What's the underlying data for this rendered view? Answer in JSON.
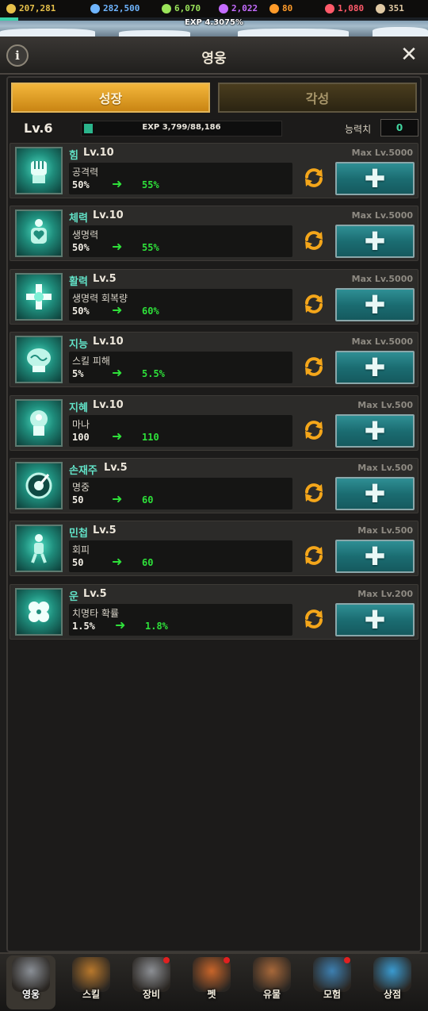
{
  "resources": [
    {
      "icon": "gold-coin-icon",
      "value": "207,281",
      "color": "#e6c04a"
    },
    {
      "icon": "diamond-icon",
      "value": "282,500",
      "color": "#6fb5ff"
    },
    {
      "icon": "green-gem-icon",
      "value": "6,070",
      "color": "#9be45a"
    },
    {
      "icon": "purple-gem-icon",
      "value": "2,022",
      "color": "#c56cff"
    },
    {
      "icon": "orange-crystal-icon",
      "value": "80",
      "color": "#ff9b2a"
    },
    {
      "icon": "red-ruby-icon",
      "value": "1,080",
      "color": "#ff5a6a"
    },
    {
      "icon": "brown-scroll-icon",
      "value": "351",
      "color": "#e0c9a4"
    }
  ],
  "exp_top": {
    "text": "EXP 4.3075%",
    "fraction": 0.043075
  },
  "header": {
    "title": "영웅",
    "info_label": "i",
    "close_label": "✕"
  },
  "tabs": {
    "growth": "성장",
    "awaken": "각성"
  },
  "level": {
    "label": "Lv.6",
    "exp_text": "EXP 3,799/88,186",
    "exp_fraction": 0.043,
    "points_label": "능력치",
    "points_value": "0"
  },
  "stats": [
    {
      "name": "힘",
      "level": "Lv.10",
      "max": "Max Lv.5000",
      "effect": "공격력",
      "from": "50%",
      "to": "55%",
      "icon": "fist-icon"
    },
    {
      "name": "체력",
      "level": "Lv.10",
      "max": "Max Lv.5000",
      "effect": "생명력",
      "from": "50%",
      "to": "55%",
      "icon": "heart-body-icon"
    },
    {
      "name": "활력",
      "level": "Lv.5",
      "max": "Max Lv.5000",
      "effect": "생명력 회복량",
      "from": "50%",
      "to": "60%",
      "icon": "cross-icon"
    },
    {
      "name": "지능",
      "level": "Lv.10",
      "max": "Max Lv.5000",
      "effect": "스킬 피해",
      "from": "5%",
      "to": "5.5%",
      "icon": "brain-icon"
    },
    {
      "name": "지혜",
      "level": "Lv.10",
      "max": "Max Lv.500",
      "effect": "마나",
      "from": "100",
      "to": "110",
      "icon": "head-glow-icon"
    },
    {
      "name": "손재주",
      "level": "Lv.5",
      "max": "Max Lv.500",
      "effect": "명중",
      "from": "50",
      "to": "60",
      "icon": "target-icon"
    },
    {
      "name": "민첩",
      "level": "Lv.5",
      "max": "Max Lv.500",
      "effect": "회피",
      "from": "50",
      "to": "60",
      "icon": "dodge-figure-icon"
    },
    {
      "name": "운",
      "level": "Lv.5",
      "max": "Max Lv.200",
      "effect": "치명타 확률",
      "from": "1.5%",
      "to": "1.8%",
      "icon": "clover-icon"
    }
  ],
  "nav": [
    {
      "label": "영웅",
      "icon": "hero-helmet-icon",
      "color": "#8a8f96",
      "active": true,
      "alert": false
    },
    {
      "label": "스킬",
      "icon": "skill-book-icon",
      "color": "#b8782c",
      "active": false,
      "alert": false
    },
    {
      "label": "장비",
      "icon": "equipment-icon",
      "color": "#8c8f94",
      "active": false,
      "alert": true
    },
    {
      "label": "펫",
      "icon": "pet-icon",
      "color": "#c8652a",
      "active": false,
      "alert": true
    },
    {
      "label": "유물",
      "icon": "relic-chest-icon",
      "color": "#a7683a",
      "active": false,
      "alert": false
    },
    {
      "label": "모험",
      "icon": "adventure-compass-icon",
      "color": "#3d7fb0",
      "active": false,
      "alert": true
    },
    {
      "label": "상점",
      "icon": "shop-treasure-icon",
      "color": "#3a9ad0",
      "active": false,
      "alert": false
    }
  ]
}
